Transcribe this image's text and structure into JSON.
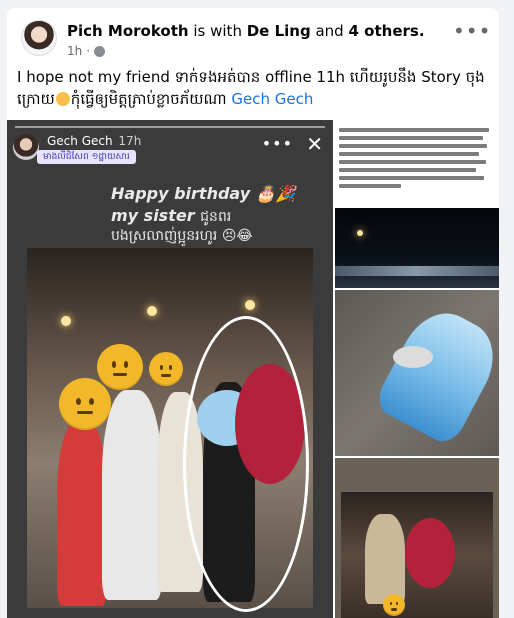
{
  "post": {
    "author": "Pich Morokoth",
    "is_with_text": "is with",
    "with_person": "De Ling",
    "and_text": "and",
    "others": "4 others.",
    "time": "1h",
    "dot": "·",
    "more": "•••",
    "caption_before": "I hope not my friend ទាក់ទងអត់បាន offline 11h ហើយរូបនឹង Story ចុងក្រោយ",
    "caption_after": "កុំធ្វើឲ្យមិត្តភ្រាប់ខ្លាចភ័យណា",
    "caption_tag": "Gech Gech"
  },
  "story": {
    "user": "Gech Gech",
    "time": "17h",
    "location": "មាងលីជិសែព ១ដ្ឋាយសារ",
    "more": "•••",
    "close": "✕",
    "line1": "Happy birthday 🎂🎉",
    "line2_en": "my sister",
    "line2_kh": "ជូនពរ",
    "line3": "បងស្រលាញ់ប្អូនរហូរ 😣😂"
  },
  "icons": {
    "avatar": "avatar",
    "globe": "globe-icon",
    "more": "more-icon",
    "close": "close-icon"
  },
  "colors": {
    "link": "#1b74e4",
    "text": "#050505",
    "muted": "#65676b",
    "background": "#f0f2f5"
  }
}
